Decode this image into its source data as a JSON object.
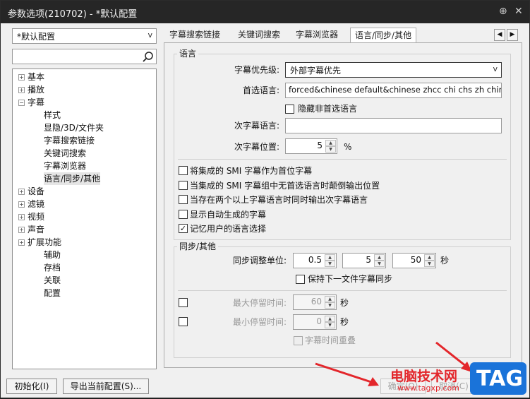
{
  "window": {
    "title": "参数选项(210702) - *默认配置",
    "pin_glyph": "⊕",
    "close_glyph": "✕"
  },
  "profile_select": {
    "value": "*默认配置",
    "arrow": "v"
  },
  "tree": {
    "items": [
      {
        "label": "基本",
        "level": 0,
        "expander": "+"
      },
      {
        "label": "播放",
        "level": 0,
        "expander": "+"
      },
      {
        "label": "字幕",
        "level": 0,
        "expander": "−"
      },
      {
        "label": "样式",
        "level": 1
      },
      {
        "label": "显隐/3D/文件夹",
        "level": 1
      },
      {
        "label": "字幕搜索链接",
        "level": 1
      },
      {
        "label": "关键词搜索",
        "level": 1
      },
      {
        "label": "字幕浏览器",
        "level": 1
      },
      {
        "label": "语言/同步/其他",
        "level": 1,
        "selected": true
      },
      {
        "label": "设备",
        "level": 0,
        "expander": "+"
      },
      {
        "label": "滤镜",
        "level": 0,
        "expander": "+"
      },
      {
        "label": "视频",
        "level": 0,
        "expander": "+"
      },
      {
        "label": "声音",
        "level": 0,
        "expander": "+"
      },
      {
        "label": "扩展功能",
        "level": 0,
        "expander": "+"
      },
      {
        "label": "辅助",
        "level": 1
      },
      {
        "label": "存档",
        "level": 1
      },
      {
        "label": "关联",
        "level": 1
      },
      {
        "label": "配置",
        "level": 1
      }
    ]
  },
  "tabs": [
    "字幕搜索链接",
    "关键词搜索",
    "字幕浏览器",
    "语言/同步/其他"
  ],
  "tab_nav": {
    "prev": "◀",
    "next": "▶"
  },
  "language": {
    "group_label": "语言",
    "priority_label": "字幕优先级:",
    "priority_value": "外部字幕优先",
    "preferred_label": "首选语言:",
    "preferred_value": "forced&chinese default&chinese zhcc chi chs zh chinese",
    "hide_nonpref": "隐藏非首选语言",
    "secondary_label": "次字幕语言:",
    "secondary_value": "",
    "secondary_pos_label": "次字幕位置:",
    "secondary_pos_value": "5",
    "percent": "%"
  },
  "checks": [
    {
      "label": "将集成的 SMI 字幕作为首位字幕",
      "checked": false
    },
    {
      "label": "当集成的 SMI 字幕组中无首选语言时颠倒输出位置",
      "checked": false
    },
    {
      "label": "当存在两个以上字幕语言时同时输出次字幕语言",
      "checked": false
    },
    {
      "label": "显示自动生成的字幕",
      "checked": false
    },
    {
      "label": "记忆用户的语言选择",
      "checked": true
    }
  ],
  "sync": {
    "group_label": "同步/其他",
    "unit_label": "同步调整单位:",
    "v1": "0.5",
    "v2": "5",
    "v3": "50",
    "sec": "秒",
    "keep_sync": "保持下一文件字幕同步",
    "max_label": "最大停留时间:",
    "max_value": "60",
    "min_label": "最小停留时间:",
    "min_value": "0",
    "overlap": "字幕时间重叠"
  },
  "footer": {
    "init": "初始化(I)",
    "export": "导出当前配置(S)...",
    "ok": "确定(O)",
    "cancel": "取消(C)"
  },
  "watermark": {
    "site": "电脑技术网",
    "url": "www.tagxp.com",
    "tag": "TAG"
  },
  "colors": {
    "arrow": "#e3262b",
    "tag_bg": "#1a73d9",
    "site": "#e3262b"
  }
}
